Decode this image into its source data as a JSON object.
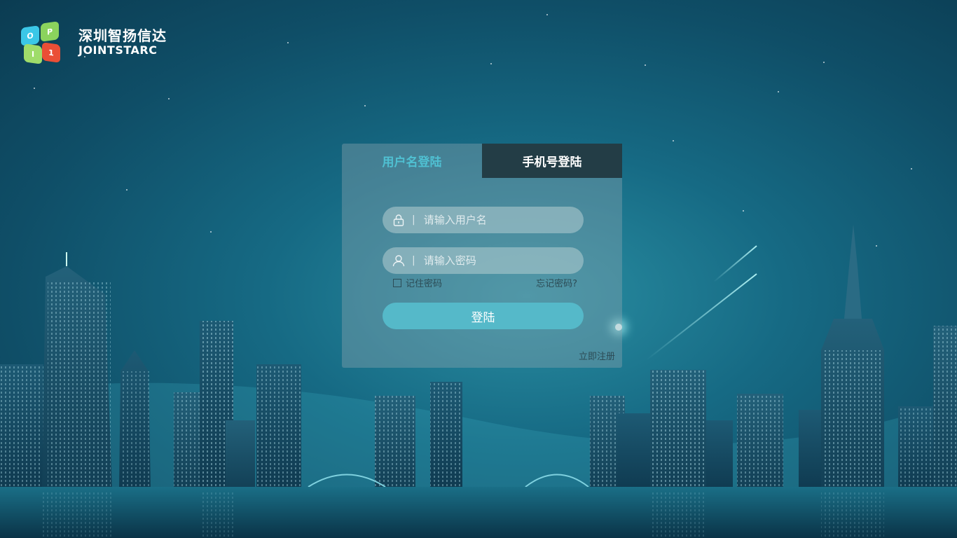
{
  "brand": {
    "name_cn": "深圳智扬信达",
    "name_en": "JOINTSTARC",
    "logo_letters": [
      "O",
      "P",
      "I",
      "1"
    ]
  },
  "login": {
    "tabs": [
      {
        "label": "用户名登陆",
        "active": true
      },
      {
        "label": "手机号登陆",
        "active": false
      }
    ],
    "username_placeholder": "请输入用户名",
    "password_placeholder": "请输入密码",
    "separator": "|",
    "remember_label": "记住密码",
    "forgot_label": "忘记密码?",
    "submit_label": "登陆",
    "register_label": "立即注册"
  },
  "icons": {
    "username_field": "lock-icon",
    "password_field": "user-icon"
  },
  "colors": {
    "accent": "#55b9c9",
    "active_tab_text": "#4fc0d2",
    "inactive_tab_bg": "#233d46",
    "background": "#0f4e67"
  }
}
